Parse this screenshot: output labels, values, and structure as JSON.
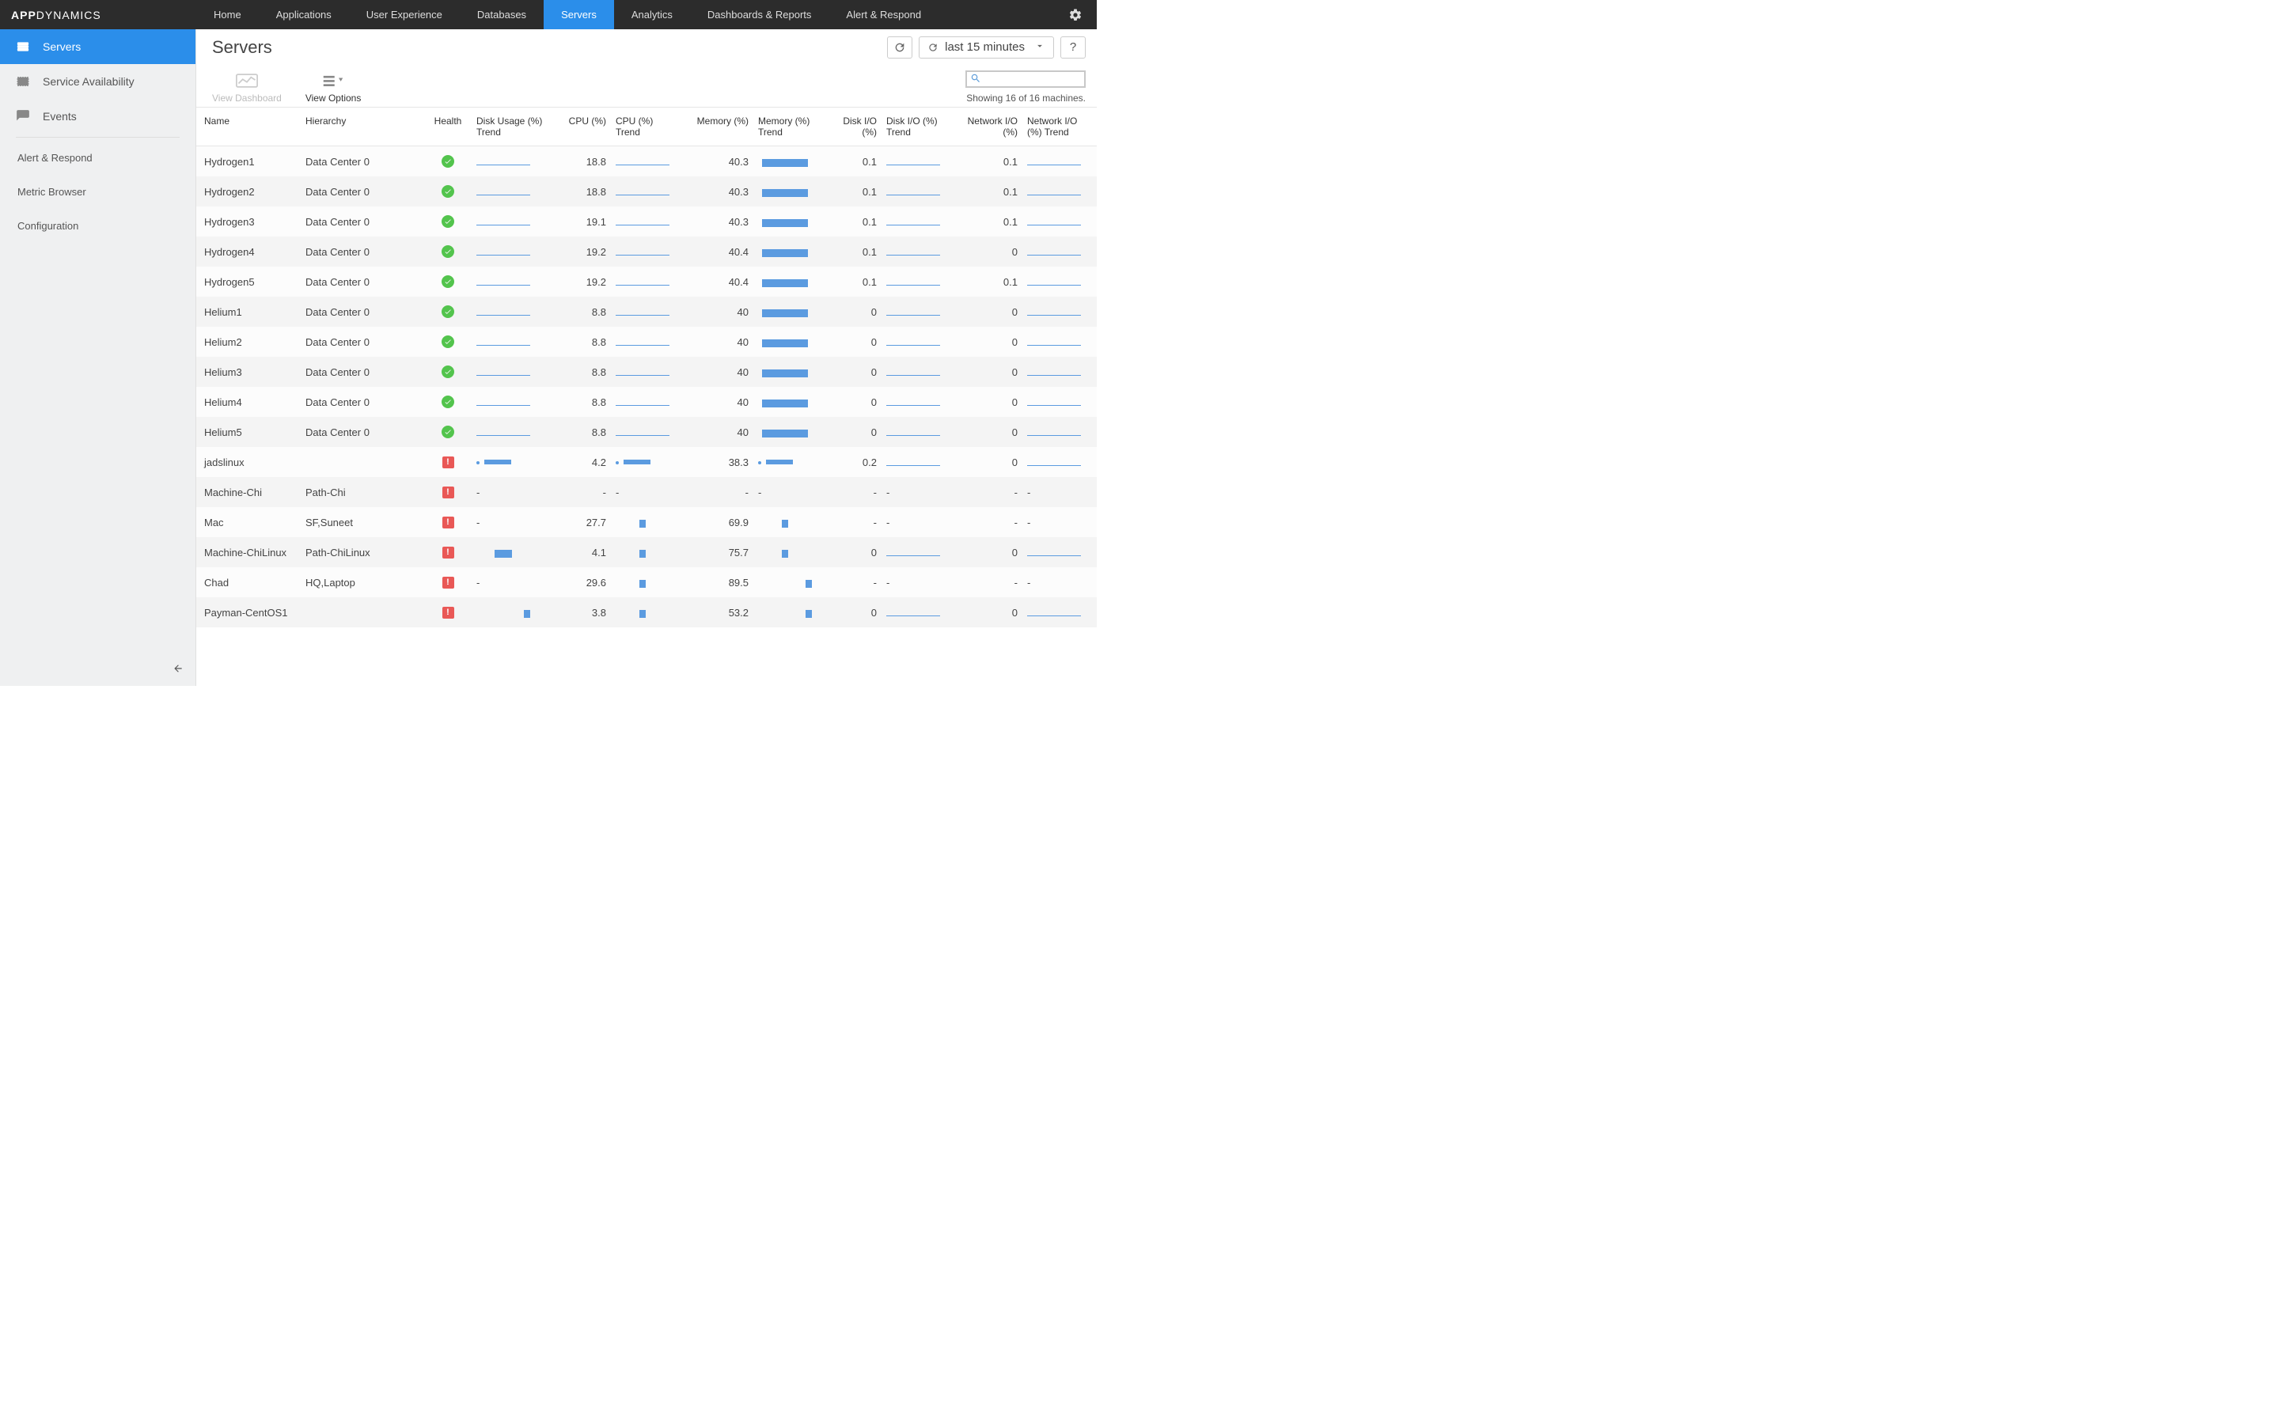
{
  "brand": {
    "strong": "APP",
    "light": "DYNAMICS"
  },
  "topnav": [
    {
      "label": "Home",
      "active": false
    },
    {
      "label": "Applications",
      "active": false
    },
    {
      "label": "User Experience",
      "active": false
    },
    {
      "label": "Databases",
      "active": false
    },
    {
      "label": "Servers",
      "active": true
    },
    {
      "label": "Analytics",
      "active": false
    },
    {
      "label": "Dashboards & Reports",
      "active": false
    },
    {
      "label": "Alert & Respond",
      "active": false
    }
  ],
  "sidebar": {
    "primary": [
      {
        "id": "servers",
        "icon": "stack",
        "label": "Servers",
        "active": true
      },
      {
        "id": "service-availability",
        "icon": "check",
        "label": "Service Availability",
        "active": false
      },
      {
        "id": "events",
        "icon": "chat",
        "label": "Events",
        "active": false
      }
    ],
    "secondary": [
      {
        "id": "alert-respond",
        "label": "Alert & Respond"
      },
      {
        "id": "metric-browser",
        "label": "Metric Browser"
      },
      {
        "id": "configuration",
        "label": "Configuration"
      }
    ]
  },
  "header": {
    "title": "Servers",
    "time_range": "last 15 minutes",
    "help_label": "?"
  },
  "toolbar": {
    "view_dashboard": "View Dashboard",
    "view_options": "View Options",
    "showing": "Showing 16 of 16 machines."
  },
  "columns": [
    {
      "key": "name",
      "label": "Name",
      "class": "c-name",
      "align": "left"
    },
    {
      "key": "hierarchy",
      "label": "Hierarchy",
      "class": "c-hier",
      "align": "left"
    },
    {
      "key": "health",
      "label": "Health",
      "class": "c-health",
      "align": "left",
      "type": "health"
    },
    {
      "key": "disk_trend",
      "label": "Disk Usage (%) Trend",
      "class": "c-dut",
      "align": "left",
      "type": "trend"
    },
    {
      "key": "cpu",
      "label": "CPU (%)",
      "class": "c-cpu",
      "align": "right"
    },
    {
      "key": "cpu_trend",
      "label": "CPU (%) Trend",
      "class": "c-cput",
      "align": "left",
      "type": "trend"
    },
    {
      "key": "mem",
      "label": "Memory (%)",
      "class": "c-mem",
      "align": "right"
    },
    {
      "key": "mem_trend",
      "label": "Memory (%) Trend",
      "class": "c-memt",
      "align": "left",
      "type": "bar"
    },
    {
      "key": "diskio",
      "label": "Disk I/O (%)",
      "class": "c-dio",
      "align": "right"
    },
    {
      "key": "diskio_trend",
      "label": "Disk I/O (%) Trend",
      "class": "c-diot",
      "align": "left",
      "type": "trend"
    },
    {
      "key": "netio",
      "label": "Network I/O (%)",
      "class": "c-nio",
      "align": "right"
    },
    {
      "key": "netio_trend",
      "label": "Network I/O (%) Trend",
      "class": "c-niot",
      "align": "left",
      "type": "trend"
    }
  ],
  "rows": [
    {
      "name": "Hydrogen1",
      "hierarchy": "Data Center 0",
      "health": "ok",
      "disk_trend": "low",
      "cpu": "18.8",
      "cpu_trend": "low",
      "mem": "40.3",
      "mem_trend": "mid",
      "diskio": "0.1",
      "diskio_trend": "low",
      "netio": "0.1",
      "netio_trend": "low"
    },
    {
      "name": "Hydrogen2",
      "hierarchy": "Data Center 0",
      "health": "ok",
      "disk_trend": "low",
      "cpu": "18.8",
      "cpu_trend": "low",
      "mem": "40.3",
      "mem_trend": "mid",
      "diskio": "0.1",
      "diskio_trend": "low",
      "netio": "0.1",
      "netio_trend": "low"
    },
    {
      "name": "Hydrogen3",
      "hierarchy": "Data Center 0",
      "health": "ok",
      "disk_trend": "low",
      "cpu": "19.1",
      "cpu_trend": "low",
      "mem": "40.3",
      "mem_trend": "mid",
      "diskio": "0.1",
      "diskio_trend": "low",
      "netio": "0.1",
      "netio_trend": "low"
    },
    {
      "name": "Hydrogen4",
      "hierarchy": "Data Center 0",
      "health": "ok",
      "disk_trend": "low",
      "cpu": "19.2",
      "cpu_trend": "low",
      "mem": "40.4",
      "mem_trend": "mid",
      "diskio": "0.1",
      "diskio_trend": "low",
      "netio": "0",
      "netio_trend": "low"
    },
    {
      "name": "Hydrogen5",
      "hierarchy": "Data Center 0",
      "health": "ok",
      "disk_trend": "low",
      "cpu": "19.2",
      "cpu_trend": "low",
      "mem": "40.4",
      "mem_trend": "mid",
      "diskio": "0.1",
      "diskio_trend": "low",
      "netio": "0.1",
      "netio_trend": "low"
    },
    {
      "name": "Helium1",
      "hierarchy": "Data Center 0",
      "health": "ok",
      "disk_trend": "low",
      "cpu": "8.8",
      "cpu_trend": "low",
      "mem": "40",
      "mem_trend": "mid",
      "diskio": "0",
      "diskio_trend": "low",
      "netio": "0",
      "netio_trend": "low"
    },
    {
      "name": "Helium2",
      "hierarchy": "Data Center 0",
      "health": "ok",
      "disk_trend": "low",
      "cpu": "8.8",
      "cpu_trend": "low",
      "mem": "40",
      "mem_trend": "mid",
      "diskio": "0",
      "diskio_trend": "low",
      "netio": "0",
      "netio_trend": "low"
    },
    {
      "name": "Helium3",
      "hierarchy": "Data Center 0",
      "health": "ok",
      "disk_trend": "low",
      "cpu": "8.8",
      "cpu_trend": "low",
      "mem": "40",
      "mem_trend": "mid",
      "diskio": "0",
      "diskio_trend": "low",
      "netio": "0",
      "netio_trend": "low"
    },
    {
      "name": "Helium4",
      "hierarchy": "Data Center 0",
      "health": "ok",
      "disk_trend": "low",
      "cpu": "8.8",
      "cpu_trend": "low",
      "mem": "40",
      "mem_trend": "mid",
      "diskio": "0",
      "diskio_trend": "low",
      "netio": "0",
      "netio_trend": "low"
    },
    {
      "name": "Helium5",
      "hierarchy": "Data Center 0",
      "health": "ok",
      "disk_trend": "low",
      "cpu": "8.8",
      "cpu_trend": "low",
      "mem": "40",
      "mem_trend": "mid",
      "diskio": "0",
      "diskio_trend": "low",
      "netio": "0",
      "netio_trend": "low"
    },
    {
      "name": "jadslinux",
      "hierarchy": "",
      "health": "bad",
      "disk_trend": "dotbar",
      "cpu": "4.2",
      "cpu_trend": "dotbar",
      "mem": "38.3",
      "mem_trend": "dotbar",
      "diskio": "0.2",
      "diskio_trend": "low",
      "netio": "0",
      "netio_trend": "low"
    },
    {
      "name": "Machine-Chi",
      "hierarchy": "Path-Chi",
      "health": "bad",
      "disk_trend": "dash",
      "cpu": "-",
      "cpu_trend": "dash",
      "mem": "-",
      "mem_trend": "dash",
      "diskio": "-",
      "diskio_trend": "dash",
      "netio": "-",
      "netio_trend": "dash"
    },
    {
      "name": "Mac",
      "hierarchy": "SF,Suneet",
      "health": "bad",
      "disk_trend": "dash",
      "cpu": "27.7",
      "cpu_trend": "tinybar",
      "mem": "69.9",
      "mem_trend": "tinybar",
      "diskio": "-",
      "diskio_trend": "dash",
      "netio": "-",
      "netio_trend": "dash"
    },
    {
      "name": "Machine-ChiLinux",
      "hierarchy": "Path-ChiLinux",
      "health": "bad",
      "disk_trend": "midbar",
      "cpu": "4.1",
      "cpu_trend": "tinybar",
      "mem": "75.7",
      "mem_trend": "tinybar",
      "diskio": "0",
      "diskio_trend": "low",
      "netio": "0",
      "netio_trend": "low"
    },
    {
      "name": "Chad",
      "hierarchy": "HQ,Laptop",
      "health": "bad",
      "disk_trend": "dash",
      "cpu": "29.6",
      "cpu_trend": "tinybar",
      "mem": "89.5",
      "mem_trend": "tinybar-r",
      "diskio": "-",
      "diskio_trend": "dash",
      "netio": "-",
      "netio_trend": "dash"
    },
    {
      "name": "Payman-CentOS1",
      "hierarchy": "",
      "health": "bad",
      "disk_trend": "tinybar-r",
      "cpu": "3.8",
      "cpu_trend": "tinybar",
      "mem": "53.2",
      "mem_trend": "tinybar-r",
      "diskio": "0",
      "diskio_trend": "low",
      "netio": "0",
      "netio_trend": "low"
    }
  ]
}
